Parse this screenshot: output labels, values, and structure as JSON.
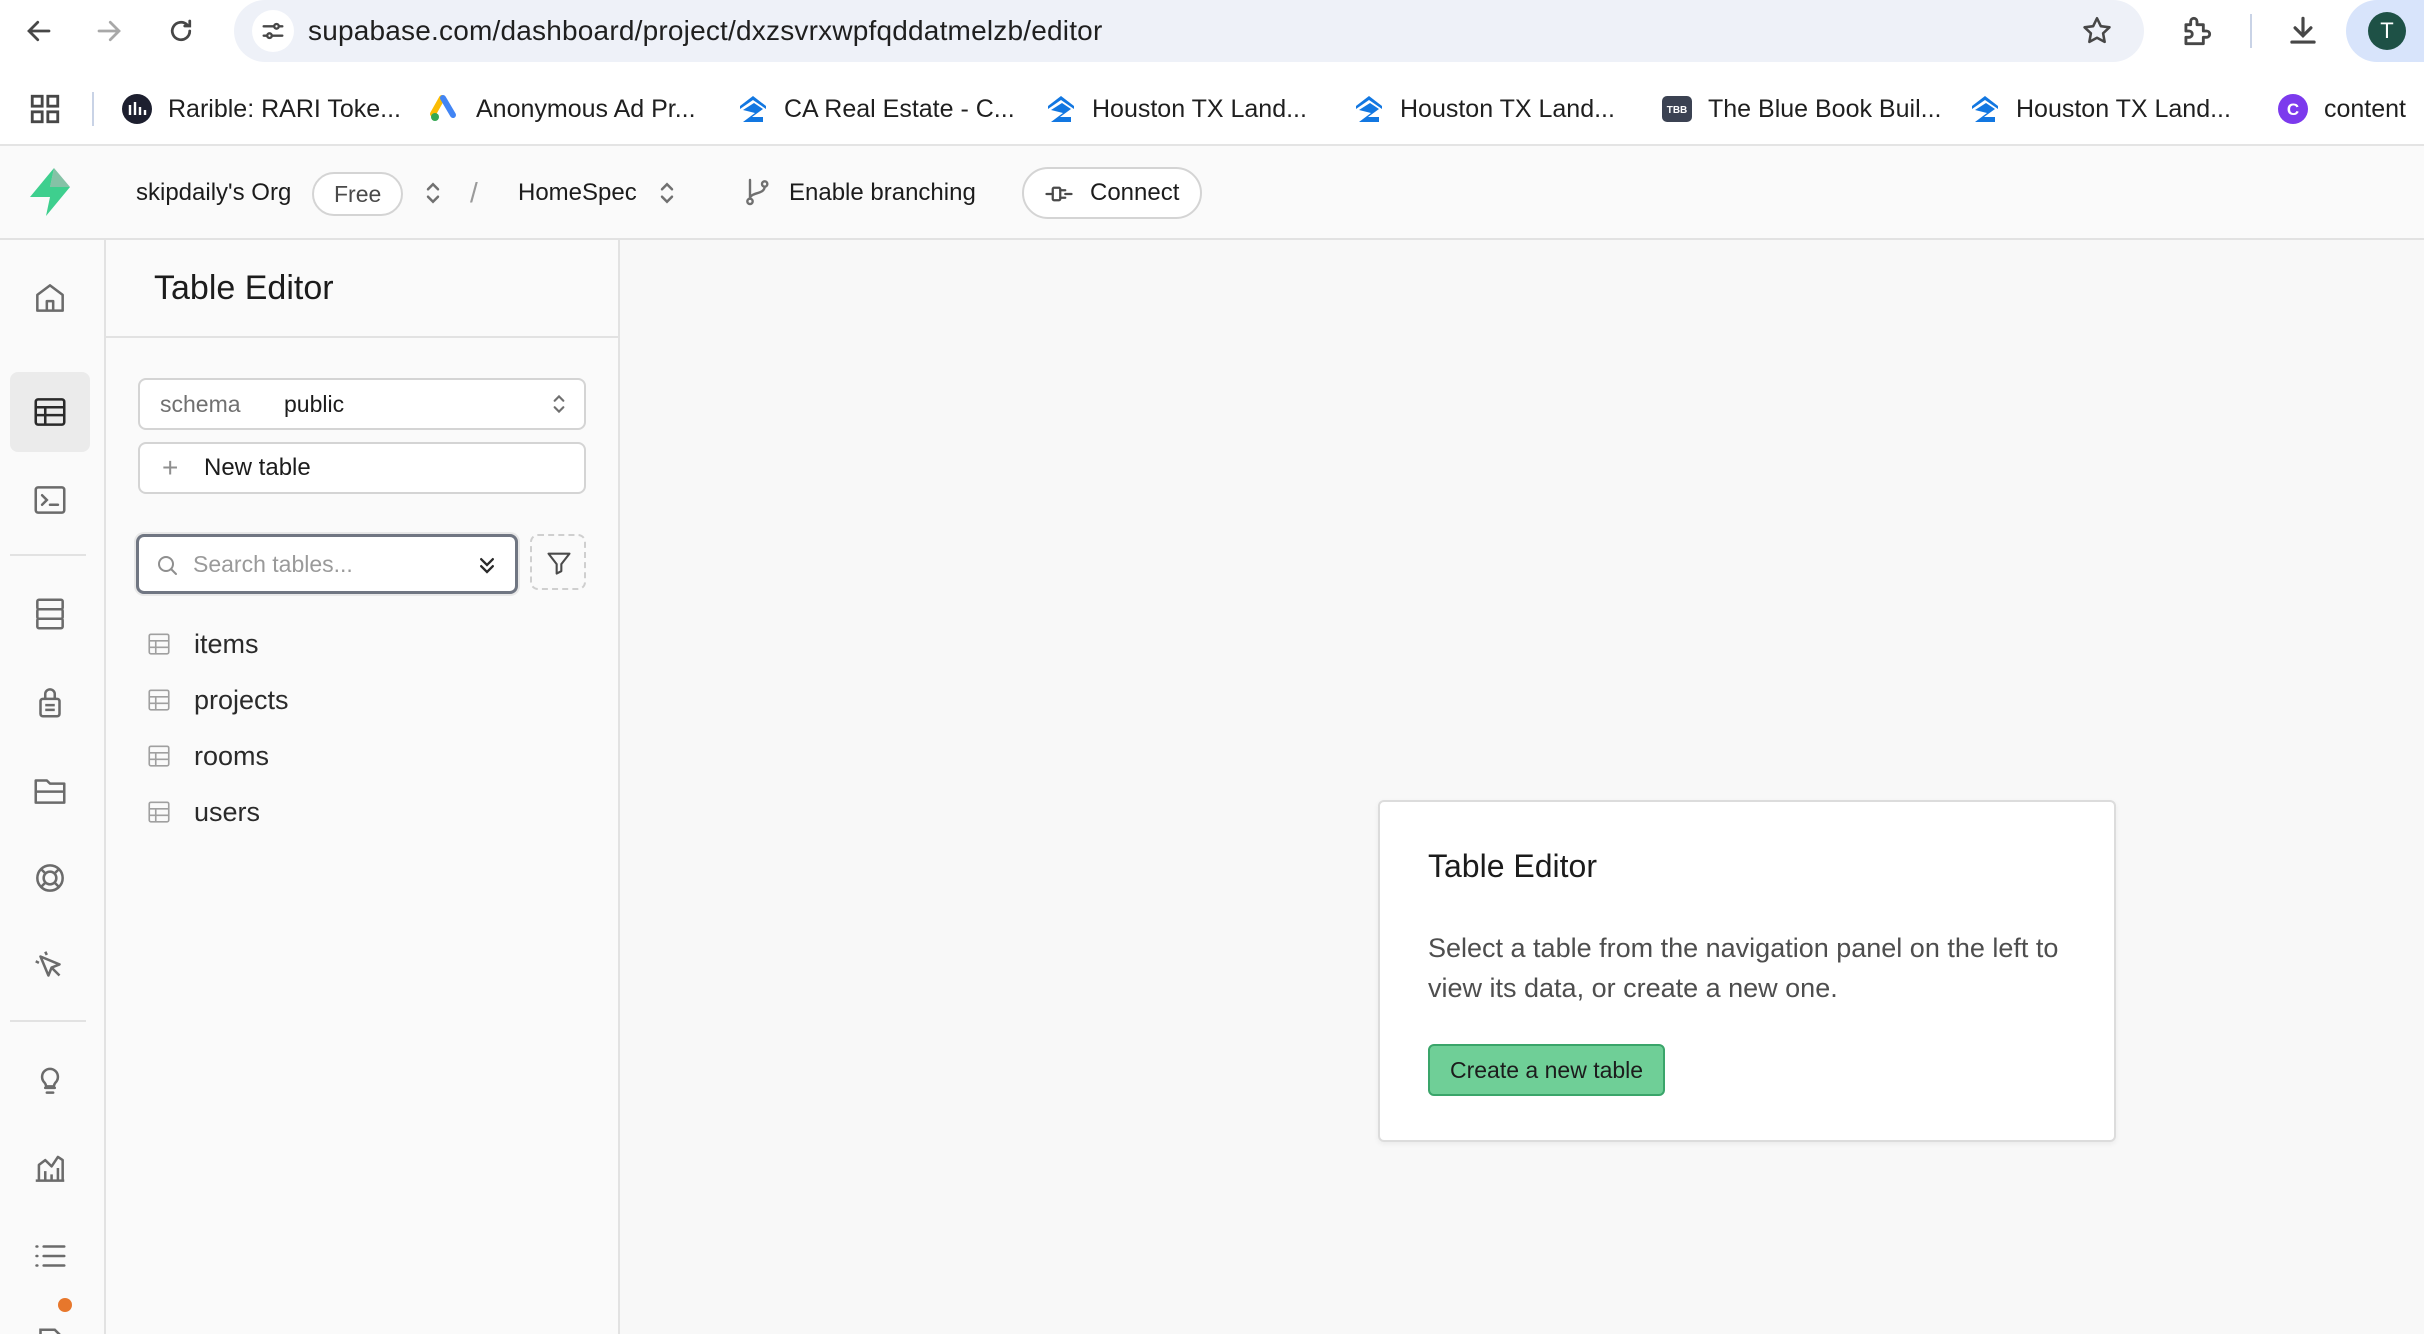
{
  "browser": {
    "url": "supabase.com/dashboard/project/dxzsvrxwpfqddatmelzb/editor",
    "profile_initial": "T",
    "bookmarks": [
      {
        "label": "Rarible: RARI Toke...",
        "icon": "rarible-icon"
      },
      {
        "label": "Anonymous Ad Pr...",
        "icon": "google-ads-icon"
      },
      {
        "label": "CA Real Estate - C...",
        "icon": "zillow-icon"
      },
      {
        "label": "Houston TX Land...",
        "icon": "zillow-icon"
      },
      {
        "label": "Houston TX Land...",
        "icon": "zillow-icon"
      },
      {
        "label": "The Blue Book Buil...",
        "icon": "tbb-icon"
      },
      {
        "label": "Houston TX Land...",
        "icon": "zillow-icon"
      },
      {
        "label": "content",
        "icon": "c-icon"
      }
    ],
    "tbb_favicon_text": "TBB",
    "c_favicon_text": "C"
  },
  "header": {
    "org_name": "skipdaily's Org",
    "plan_badge": "Free",
    "separator": "/",
    "project_name": "HomeSpec",
    "branching_label": "Enable branching",
    "connect_label": "Connect"
  },
  "sidebar": {
    "title": "Table Editor",
    "schema_label": "schema",
    "schema_value": "public",
    "new_table_label": "New table",
    "search_placeholder": "Search tables...",
    "tables": [
      "items",
      "projects",
      "rooms",
      "users"
    ]
  },
  "main": {
    "card_title": "Table Editor",
    "card_text": "Select a table from the navigation panel on the left to view its data, or create a new one.",
    "cta_label": "Create a new table"
  },
  "colors": {
    "brand_green": "#3ecf8e",
    "cta_green": "#6fcf97",
    "notification": "#e7772c",
    "profile": "#1e5146"
  }
}
